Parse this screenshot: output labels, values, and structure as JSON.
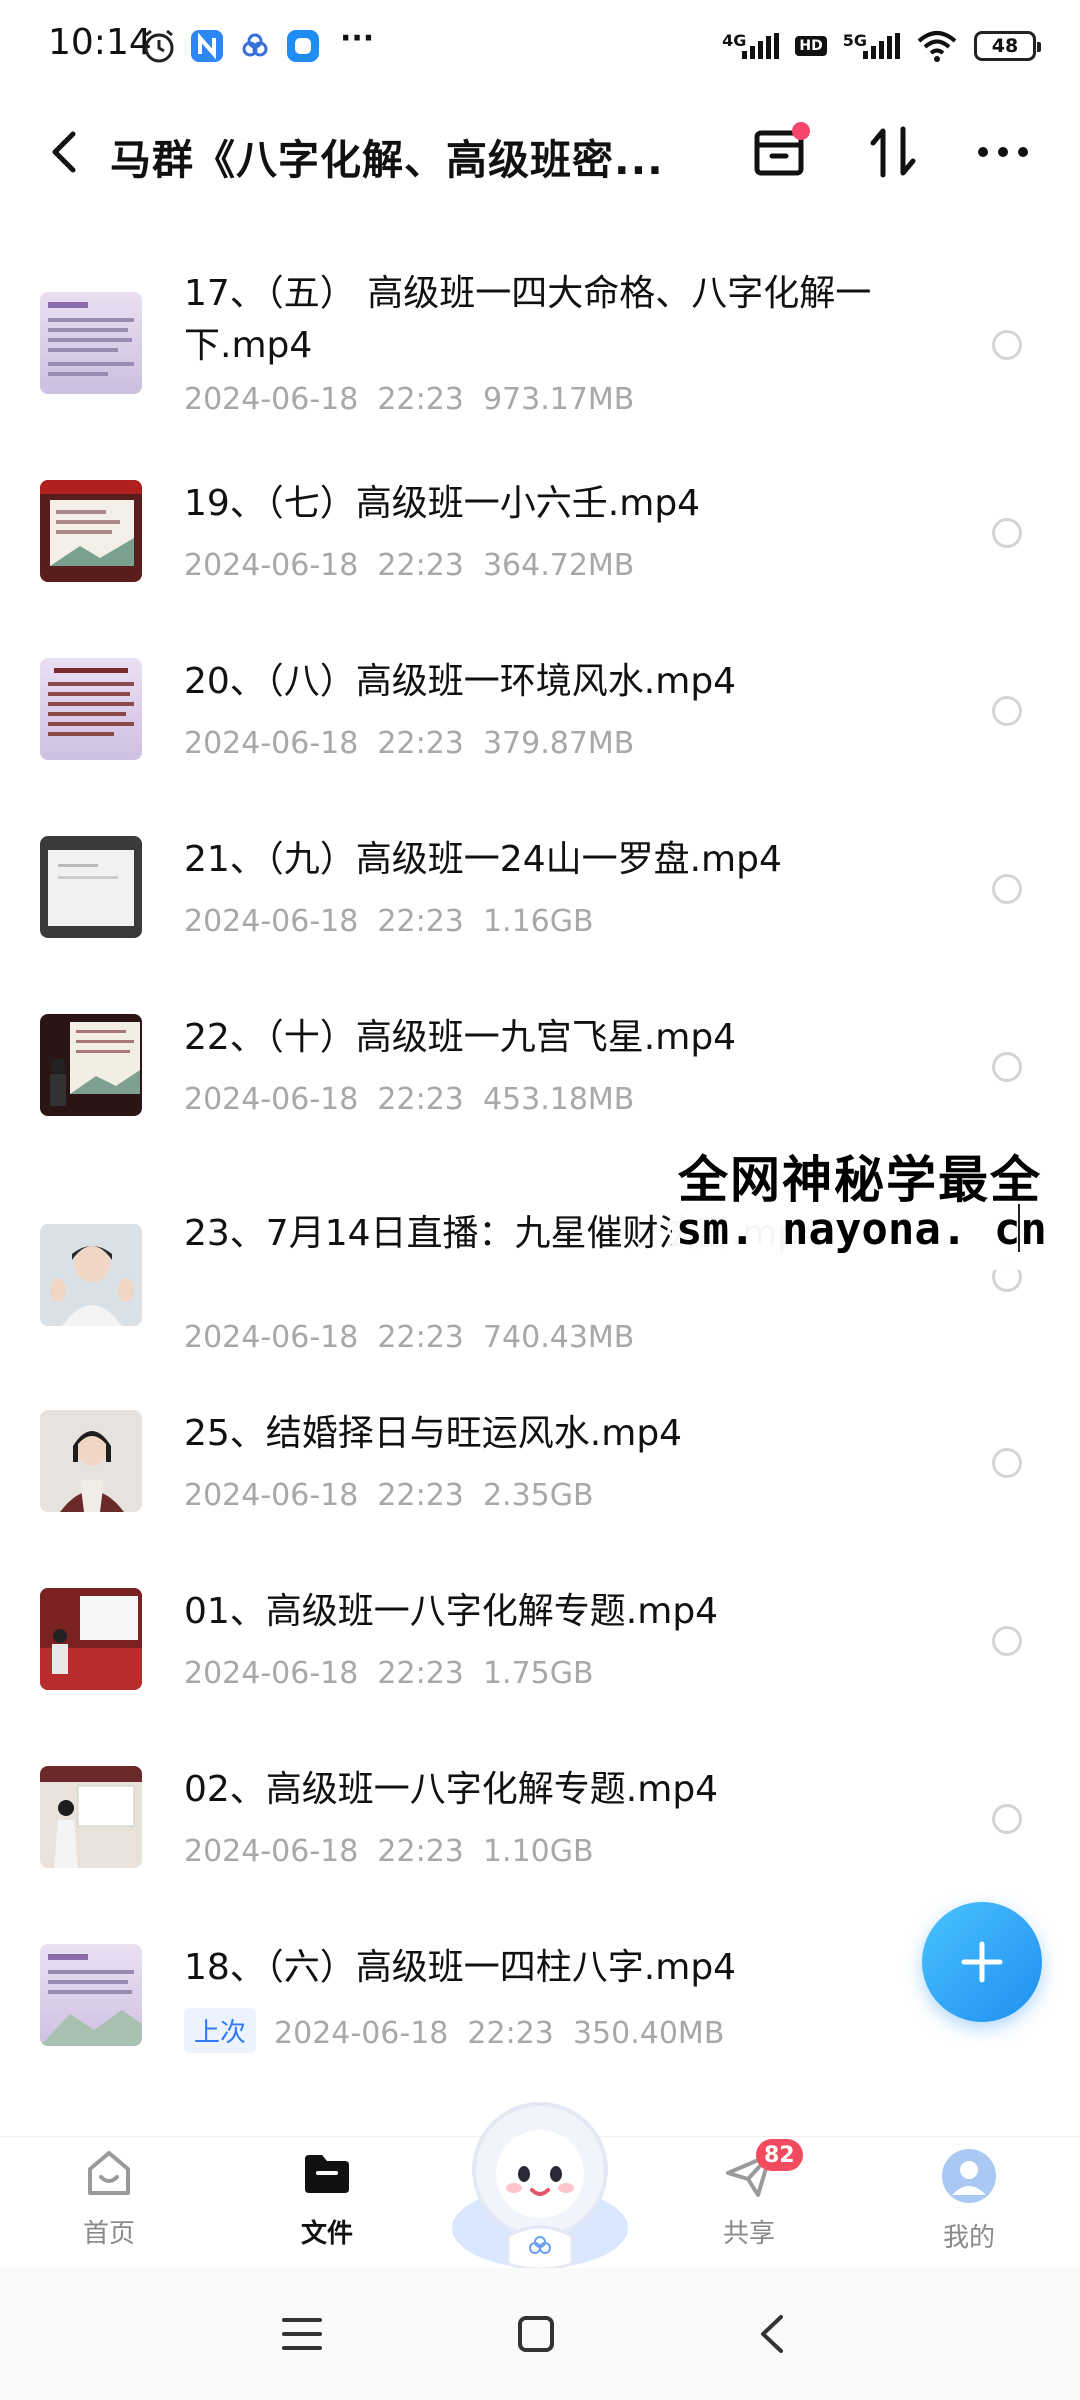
{
  "status_bar": {
    "time": "10:14",
    "network_1": "4G",
    "hd": "HD",
    "network_2": "5G",
    "battery": "48",
    "more": "···"
  },
  "header": {
    "title": "马群《八字化解、高级班密..."
  },
  "files": [
    {
      "name": "17、（五） 高级班一四大命格、八字化解一下.mp4",
      "meta": "2024-06-18  22:23  973.17MB",
      "thumb": "slide-purple"
    },
    {
      "name": "19、（七）高级班一小六壬.mp4",
      "meta": "2024-06-18  22:23  364.72MB",
      "thumb": "slide-red"
    },
    {
      "name": "20、（八）高级班一环境风水.mp4",
      "meta": "2024-06-18  22:23  379.87MB",
      "thumb": "slide-purple"
    },
    {
      "name": "21、（九）高级班一24山一罗盘.mp4",
      "meta": "2024-06-18  22:23  1.16GB",
      "thumb": "paper"
    },
    {
      "name": "22、（十）高级班一九宫飞星.mp4",
      "meta": "2024-06-18  22:23  453.18MB",
      "thumb": "presenter"
    },
    {
      "name": "23、7月14日直播：九星催财法富.mp4",
      "meta": "2024-06-18  22:23  740.43MB",
      "thumb": "woman"
    },
    {
      "name": "25、结婚择日与旺运风水.mp4",
      "meta": "2024-06-18  22:23  2.35GB",
      "thumb": "woman"
    },
    {
      "name": "01、高级班一八字化解专题.mp4",
      "meta": "2024-06-18  22:23  1.75GB",
      "thumb": "classroom"
    },
    {
      "name": "02、高级班一八字化解专题.mp4",
      "meta": "2024-06-18  22:23  1.10GB",
      "thumb": "whiteboard"
    },
    {
      "name": "18、（六）高级班一四柱八字.mp4",
      "meta": "2024-06-18  22:23  350.40MB",
      "thumb": "slide-purple",
      "badge": "上次"
    }
  ],
  "watermark": {
    "line1": "全网神秘学最全",
    "line2": "sm. nayona. cn"
  },
  "bottom_nav": {
    "home": "首页",
    "files": "文件",
    "share": "共享",
    "share_badge": "82",
    "me": "我的"
  },
  "colors": {
    "accent": "#2e7bf7",
    "badge": "#f24a5e",
    "meta": "#a8a8a8"
  }
}
